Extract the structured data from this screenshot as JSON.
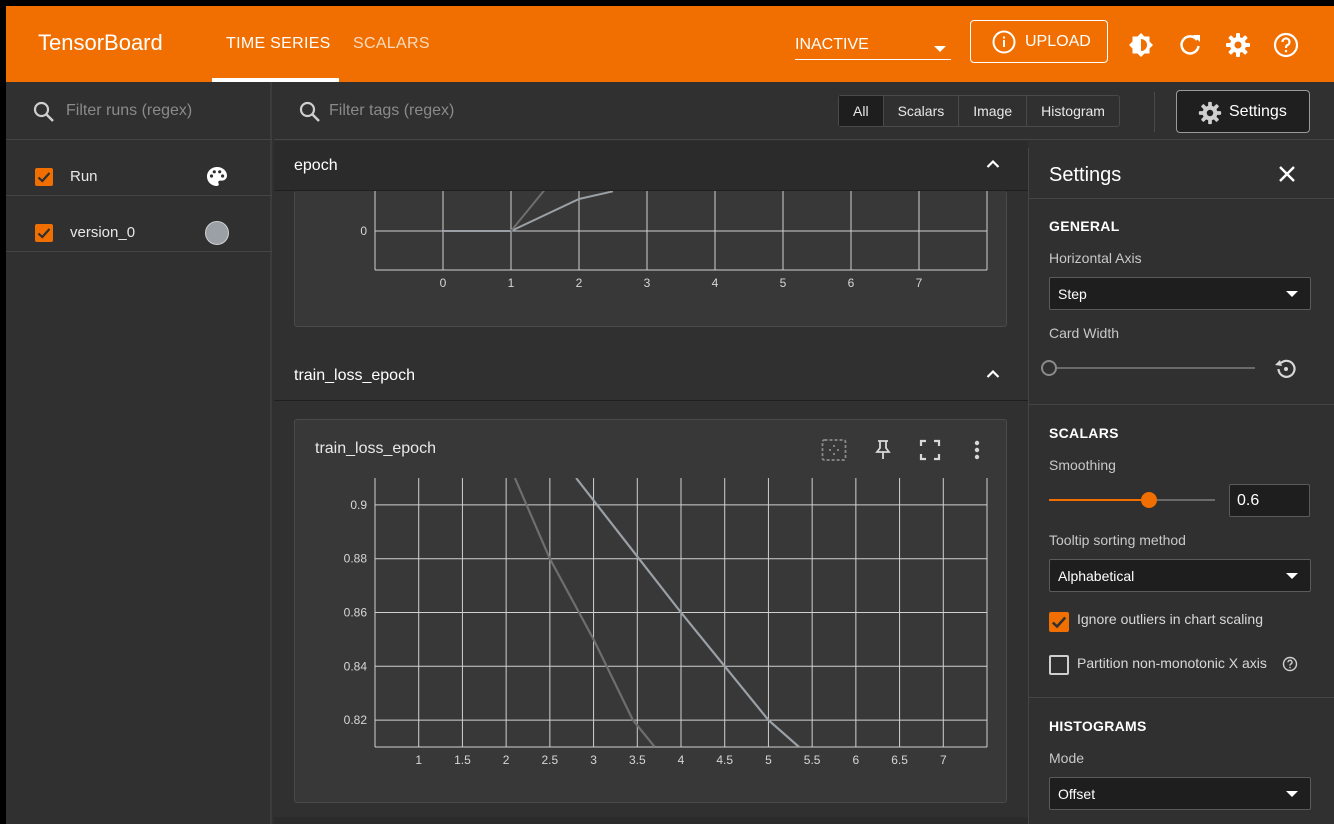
{
  "header": {
    "brand": "TensorBoard",
    "tabs": [
      {
        "label": "TIME SERIES",
        "active": true
      },
      {
        "label": "SCALARS",
        "active": false
      }
    ],
    "status_select": "INACTIVE",
    "upload_label": "UPLOAD",
    "icons": [
      "info-icon",
      "brightness-icon",
      "refresh-icon",
      "settings-gear-icon",
      "help-icon"
    ],
    "accent_color": "#f06f00"
  },
  "runs": {
    "search_placeholder": "Filter runs (regex)",
    "items": [
      {
        "label": "Run",
        "checked": true,
        "icon": "palette-icon"
      },
      {
        "label": "version_0",
        "checked": true,
        "color": "#9aa0a6"
      }
    ]
  },
  "toolbar": {
    "tags_placeholder": "Filter tags (regex)",
    "filters": [
      "All",
      "Scalars",
      "Image",
      "Histogram"
    ],
    "active_filter": "All",
    "settings_label": "Settings"
  },
  "groups": [
    {
      "title": "epoch",
      "chart_data": {
        "type": "line",
        "title": "",
        "x_ticks": [
          "0",
          "1",
          "2",
          "3",
          "4",
          "5",
          "6",
          "7"
        ],
        "y_ticks": [
          "0"
        ],
        "series": [
          {
            "color": "#9aa0a6",
            "x": [
              0,
              1,
              2,
              2.5
            ],
            "y": [
              0,
              0,
              0.5,
              0.62
            ]
          },
          {
            "color": "#6e6e6e",
            "x": [
              1,
              1.5
            ],
            "y": [
              0,
              0.65
            ]
          }
        ]
      }
    },
    {
      "title": "train_loss_epoch",
      "card_title": "train_loss_epoch",
      "card_icons": [
        "fit-domain-icon",
        "pin-icon",
        "fullscreen-icon",
        "more-vert-icon"
      ],
      "chart_data": {
        "type": "line",
        "title": "train_loss_epoch",
        "x_ticks": [
          "1",
          "1.5",
          "2",
          "2.5",
          "3",
          "3.5",
          "4",
          "4.5",
          "5",
          "5.5",
          "6",
          "6.5",
          "7"
        ],
        "y_ticks": [
          "0.9",
          "0.88",
          "0.86",
          "0.84",
          "0.82"
        ],
        "xlim": [
          0.5,
          7.5
        ],
        "ylim": [
          0.81,
          0.91
        ],
        "series": [
          {
            "color": "#9aa0a6",
            "x": [
              2.8,
              4,
              5,
              5.35
            ],
            "y": [
              0.91,
              0.86,
              0.82,
              0.81
            ]
          },
          {
            "color": "#6e6e6e",
            "x": [
              2.1,
              2.5,
              3,
              3.45,
              3.7
            ],
            "y": [
              0.91,
              0.88,
              0.85,
              0.82,
              0.81
            ]
          }
        ]
      }
    }
  ],
  "settings": {
    "title": "Settings",
    "general": {
      "section": "GENERAL",
      "horizontal_axis_label": "Horizontal Axis",
      "horizontal_axis_value": "Step",
      "card_width_label": "Card Width",
      "card_width_value": 0
    },
    "scalars": {
      "section": "SCALARS",
      "smoothing_label": "Smoothing",
      "smoothing_value": "0.6",
      "smoothing_fraction": 0.6,
      "tooltip_label": "Tooltip sorting method",
      "tooltip_value": "Alphabetical",
      "ignore_outliers_label": "Ignore outliers in chart scaling",
      "ignore_outliers": true,
      "partition_label": "Partition non-monotonic X axis",
      "partition": false
    },
    "histograms": {
      "section": "HISTOGRAMS",
      "mode_label": "Mode",
      "mode_value": "Offset"
    }
  }
}
